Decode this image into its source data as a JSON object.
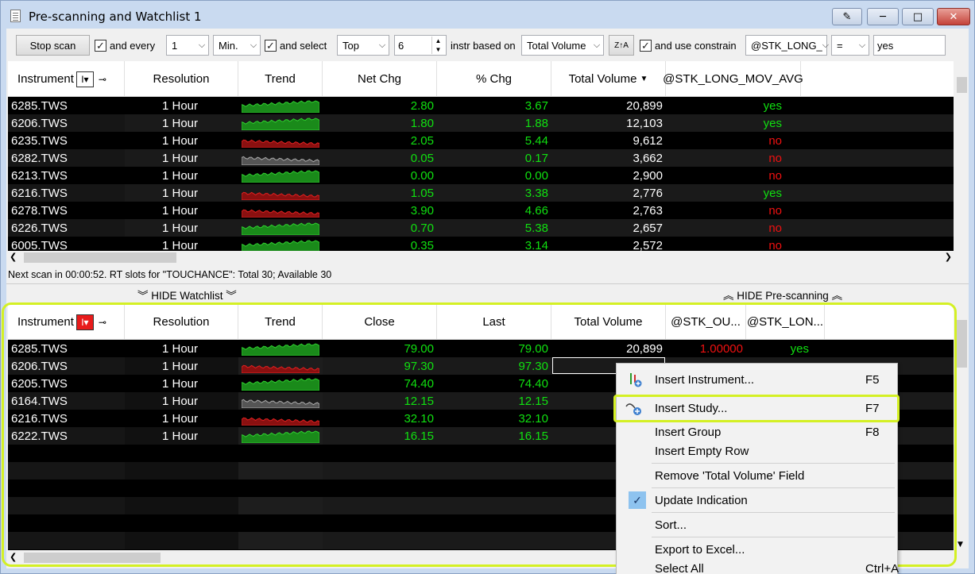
{
  "window": {
    "title": "Pre-scanning and Watchlist 1"
  },
  "toolbar": {
    "stop_scan": "Stop scan",
    "and_every": "and every",
    "interval_value": "1",
    "interval_unit": "Min.",
    "and_select": "and select",
    "select_mode": "Top",
    "select_count": "6",
    "instr_based_on": "instr based on",
    "based_on": "Total Volume",
    "and_use_constrain": "and use constrain",
    "constrain_field": "@STK_LONG_",
    "constrain_op": "=",
    "constrain_value": "yes"
  },
  "prescan": {
    "headers": [
      "Instrument",
      "Resolution",
      "Trend",
      "Net Chg",
      "% Chg",
      "Total Volume",
      "@STK_LONG_MOV_AVG"
    ],
    "rows": [
      {
        "instrument": "6285.TWS",
        "resolution": "1 Hour",
        "trend": "green",
        "net_chg": "2.80",
        "pct_chg": "3.67",
        "volume": "20,899",
        "avg": "yes"
      },
      {
        "instrument": "6206.TWS",
        "resolution": "1 Hour",
        "trend": "green",
        "net_chg": "1.80",
        "pct_chg": "1.88",
        "volume": "12,103",
        "avg": "yes"
      },
      {
        "instrument": "6235.TWS",
        "resolution": "1 Hour",
        "trend": "red",
        "net_chg": "2.05",
        "pct_chg": "5.44",
        "volume": "9,612",
        "avg": "no"
      },
      {
        "instrument": "6282.TWS",
        "resolution": "1 Hour",
        "trend": "gray",
        "net_chg": "0.05",
        "pct_chg": "0.17",
        "volume": "3,662",
        "avg": "no"
      },
      {
        "instrument": "6213.TWS",
        "resolution": "1 Hour",
        "trend": "green",
        "net_chg": "0.00",
        "pct_chg": "0.00",
        "volume": "2,900",
        "avg": "no"
      },
      {
        "instrument": "6216.TWS",
        "resolution": "1 Hour",
        "trend": "red",
        "net_chg": "1.05",
        "pct_chg": "3.38",
        "volume": "2,776",
        "avg": "yes"
      },
      {
        "instrument": "6278.TWS",
        "resolution": "1 Hour",
        "trend": "red",
        "net_chg": "3.90",
        "pct_chg": "4.66",
        "volume": "2,763",
        "avg": "no"
      },
      {
        "instrument": "6226.TWS",
        "resolution": "1 Hour",
        "trend": "green",
        "net_chg": "0.70",
        "pct_chg": "5.38",
        "volume": "2,657",
        "avg": "no"
      },
      {
        "instrument": "6005.TWS",
        "resolution": "1 Hour",
        "trend": "green",
        "net_chg": "0.35",
        "pct_chg": "3.14",
        "volume": "2,572",
        "avg": "no"
      }
    ]
  },
  "status": "Next scan in 00:00:52. RT slots for \"TOUCHANCE\": Total 30; Available 30",
  "hide_watchlist": "HIDE Watchlist",
  "hide_prescanning": "HIDE Pre-scanning",
  "watchlist": {
    "headers": [
      "Instrument",
      "Resolution",
      "Trend",
      "Close",
      "Last",
      "Total Volume",
      "@STK_OU...",
      "@STK_LON..."
    ],
    "rows": [
      {
        "instrument": "6285.TWS",
        "resolution": "1 Hour",
        "trend": "green",
        "close": "79.00",
        "last": "79.00",
        "volume": "20,899",
        "ou": "1.00000",
        "lon": "yes"
      },
      {
        "instrument": "6206.TWS",
        "resolution": "1 Hour",
        "trend": "red",
        "close": "97.30",
        "last": "97.30",
        "volume": "",
        "ou": "",
        "lon": ""
      },
      {
        "instrument": "6205.TWS",
        "resolution": "1 Hour",
        "trend": "green",
        "close": "74.40",
        "last": "74.40",
        "volume": "",
        "ou": "",
        "lon": ""
      },
      {
        "instrument": "6164.TWS",
        "resolution": "1 Hour",
        "trend": "gray",
        "close": "12.15",
        "last": "12.15",
        "volume": "",
        "ou": "",
        "lon": ""
      },
      {
        "instrument": "6216.TWS",
        "resolution": "1 Hour",
        "trend": "red",
        "close": "32.10",
        "last": "32.10",
        "volume": "",
        "ou": "",
        "lon": ""
      },
      {
        "instrument": "6222.TWS",
        "resolution": "1 Hour",
        "trend": "green",
        "close": "16.15",
        "last": "16.15",
        "volume": "",
        "ou": "",
        "lon": ""
      }
    ]
  },
  "menu": {
    "items": [
      {
        "label": "Insert Instrument...",
        "key": "F5"
      },
      {
        "label": "Insert Study...",
        "key": "F7"
      },
      {
        "label": "Insert Group",
        "key": "F8"
      },
      {
        "label": "Insert Empty Row",
        "key": ""
      },
      {
        "label": "Remove 'Total Volume' Field",
        "key": ""
      },
      {
        "label": "Update Indication",
        "key": ""
      },
      {
        "label": "Sort...",
        "key": ""
      },
      {
        "label": "Export to Excel...",
        "key": ""
      },
      {
        "label": "Select All",
        "key": "Ctrl+A"
      }
    ]
  },
  "colors": {
    "highlight": "#d4f024",
    "green": "#10e010",
    "red": "#f01010",
    "checked_bg": "#8ec3ef"
  }
}
